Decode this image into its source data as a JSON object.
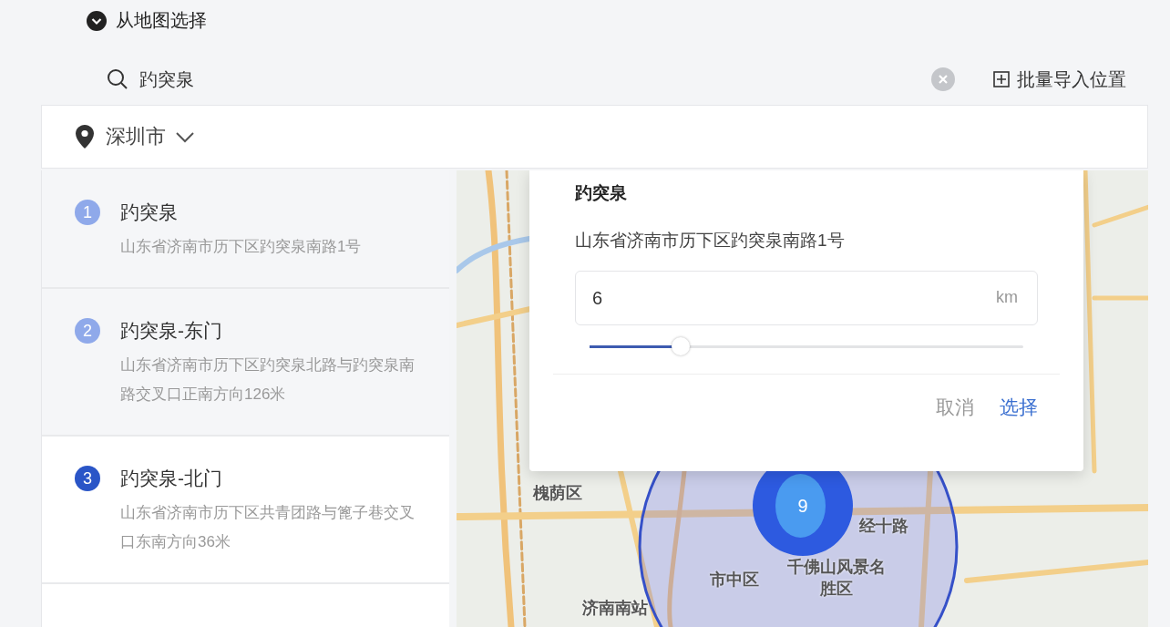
{
  "header": {
    "title": "从地图选择"
  },
  "search": {
    "value": "趵突泉"
  },
  "bulk_import": {
    "label": "批量导入位置"
  },
  "city": {
    "label": "深圳市"
  },
  "results": [
    {
      "index": "1",
      "name": "趵突泉",
      "address": "山东省济南市历下区趵突泉南路1号",
      "selected": false
    },
    {
      "index": "2",
      "name": "趵突泉-东门",
      "address": "山东省济南市历下区趵突泉北路与趵突泉南路交叉口正南方向126米",
      "selected": false
    },
    {
      "index": "3",
      "name": "趵突泉-北门",
      "address": "山东省济南市历下区共青团路与篦子巷交叉口东南方向36米",
      "selected": true
    }
  ],
  "map": {
    "labels": [
      "槐荫区",
      "市中区",
      "千佛山风景名胜区",
      "济南南站",
      "经十路"
    ],
    "cluster_count": "9"
  },
  "popup": {
    "title": "趵突泉",
    "address": "山东省济南市历下区趵突泉南路1号",
    "radius_value": "6",
    "unit": "km",
    "slider": {
      "level": 0.21
    },
    "buttons": [
      {
        "label": "取消",
        "kind": "secondary"
      },
      {
        "label": "选择",
        "kind": "primary"
      }
    ]
  }
}
